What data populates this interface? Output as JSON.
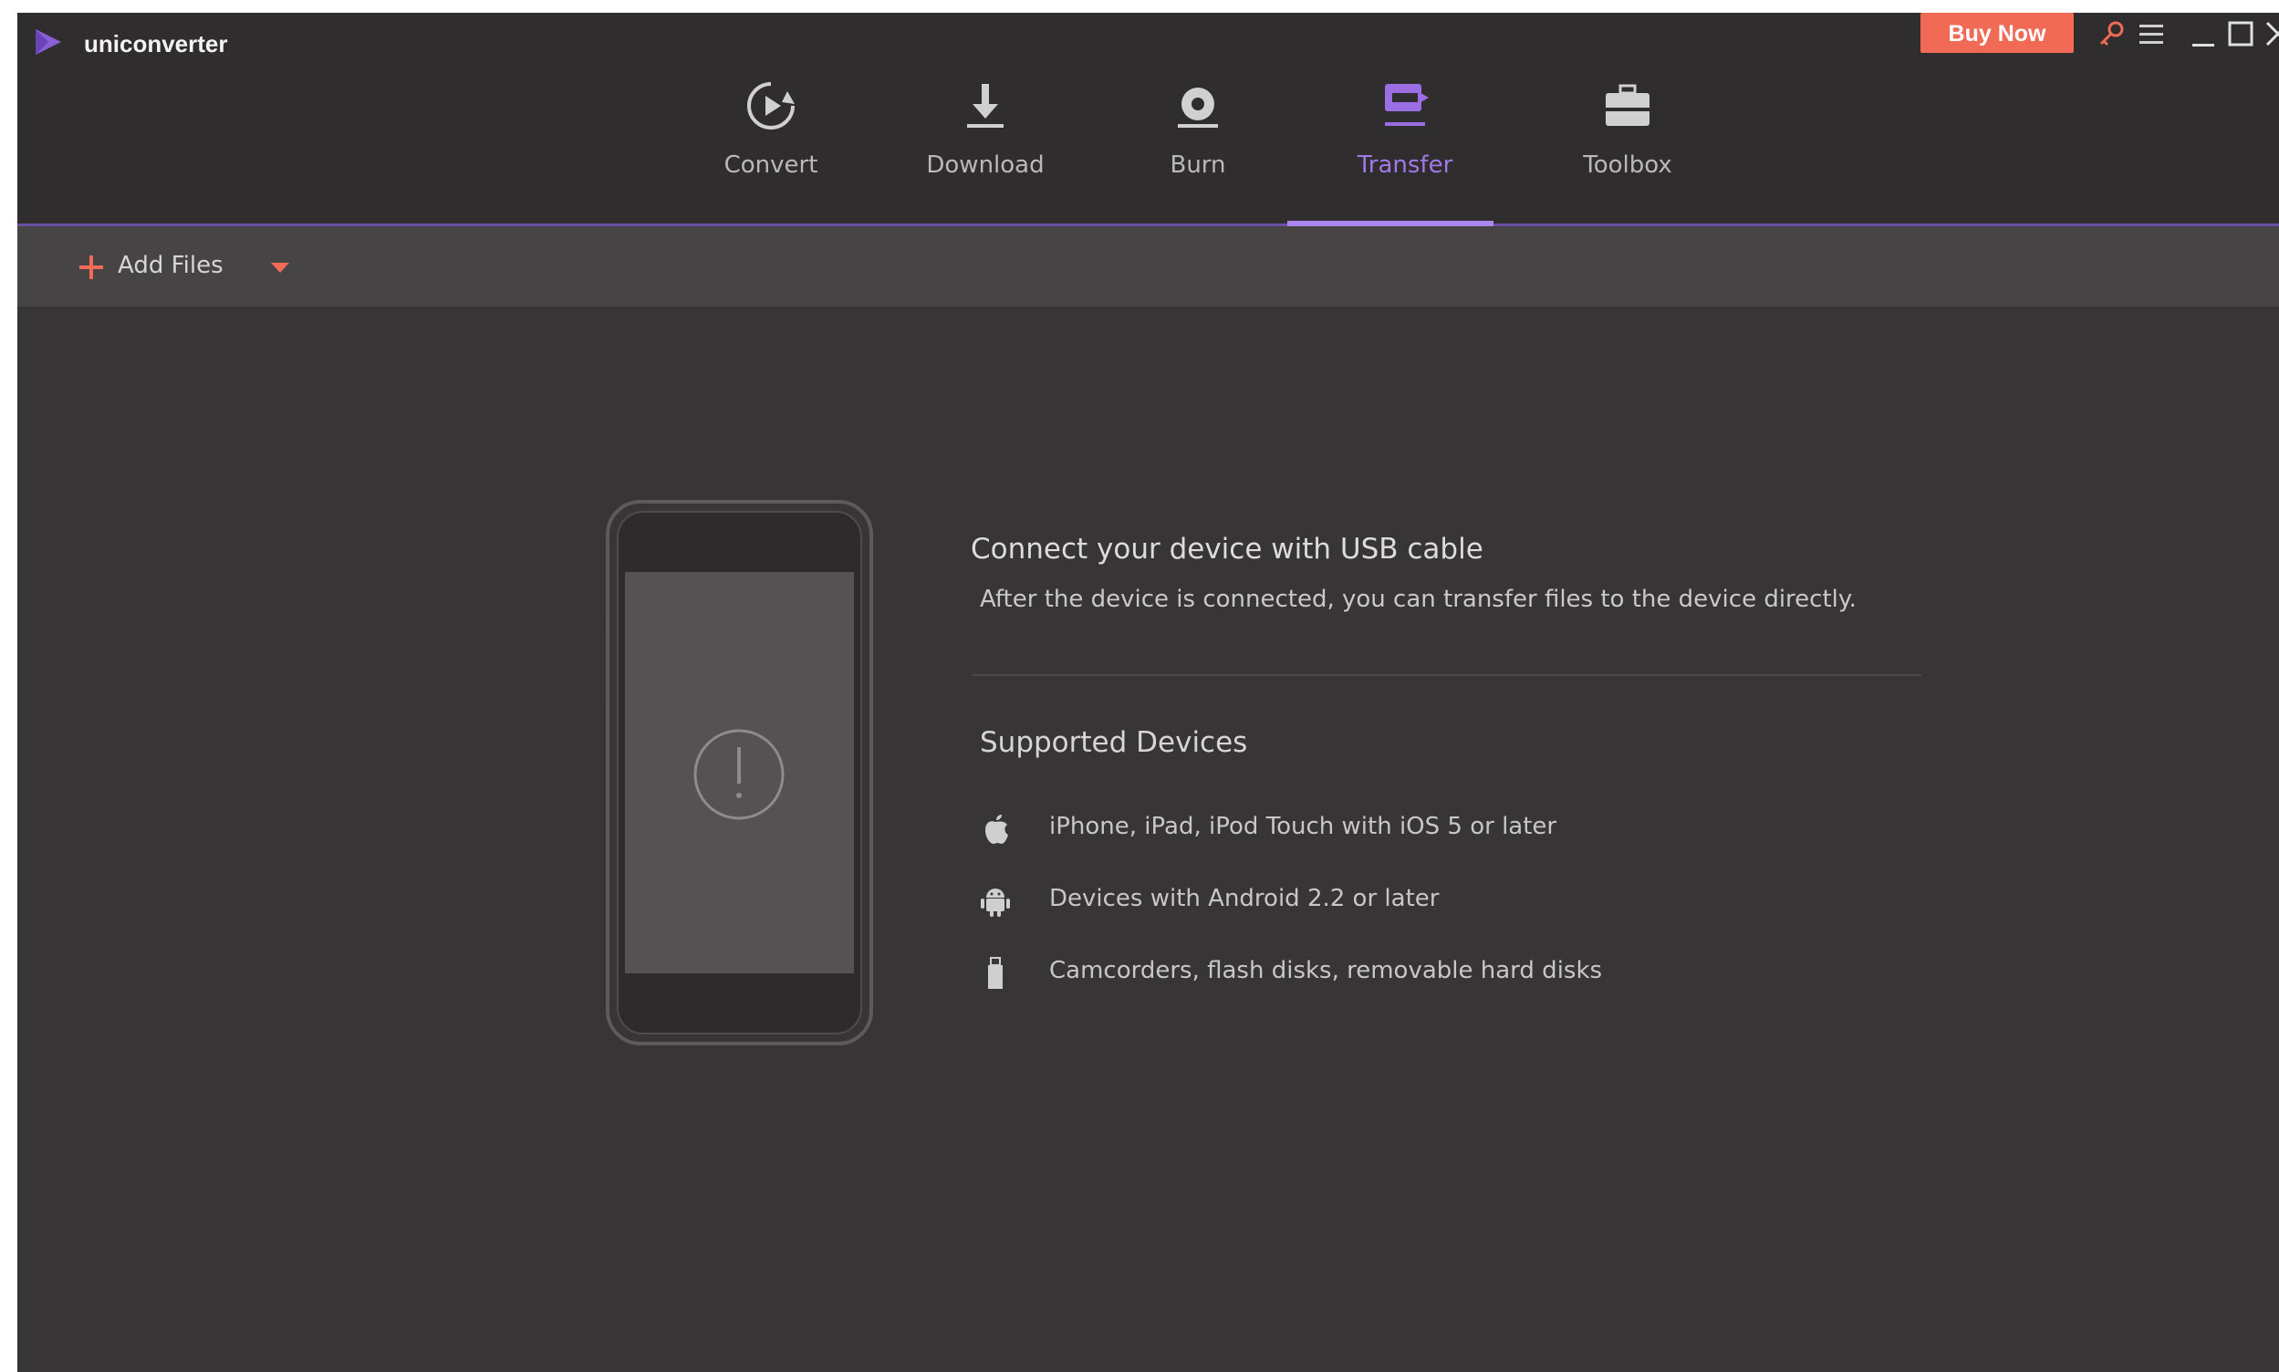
{
  "app": {
    "title": "uniconverter"
  },
  "nav": {
    "items": [
      {
        "label": "Convert",
        "icon": "convert-icon",
        "active": false
      },
      {
        "label": "Download",
        "icon": "download-icon",
        "active": false
      },
      {
        "label": "Burn",
        "icon": "burn-icon",
        "active": false
      },
      {
        "label": "Transfer",
        "icon": "transfer-icon",
        "active": true
      },
      {
        "label": "Toolbox",
        "icon": "toolbox-icon",
        "active": false
      }
    ]
  },
  "header": {
    "buy_label": "Buy Now",
    "window_controls": [
      "key-icon",
      "menu-icon",
      "minimize-icon",
      "maximize-icon",
      "close-icon"
    ]
  },
  "toolbar": {
    "add_files_label": "Add Files"
  },
  "transfer": {
    "connect_title": "Connect your device with USB cable",
    "connect_subtitle": "After the device is connected, you can transfer files to the device directly.",
    "supported_title": "Supported Devices",
    "devices": [
      {
        "icon": "apple-icon",
        "label": "iPhone, iPad, iPod Touch with iOS 5 or later"
      },
      {
        "icon": "android-icon",
        "label": "Devices with Android 2.2 or later"
      },
      {
        "icon": "usb-drive-icon",
        "label": "Camcorders, flash disks, removable hard disks"
      }
    ]
  },
  "colors": {
    "accent": "#a986f0",
    "buy_button": "#f06a55",
    "background": "#373535",
    "header": "#2f2d2d",
    "toolbar": "#464444"
  }
}
